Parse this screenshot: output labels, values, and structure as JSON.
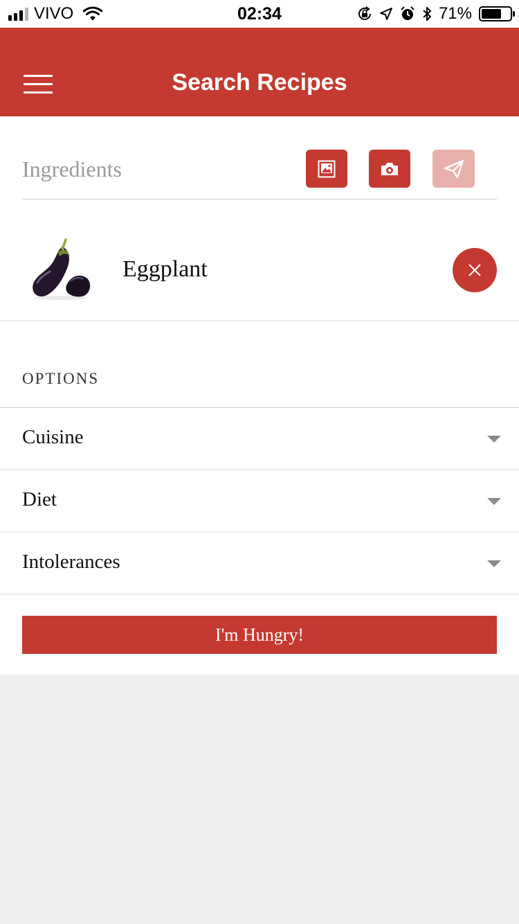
{
  "status_bar": {
    "carrier": "VIVO",
    "time": "02:34",
    "battery_percent": "71%",
    "battery_level": 0.71,
    "icons": [
      "signal-icon",
      "wifi-icon",
      "orientation-lock-icon",
      "location-icon",
      "alarm-icon",
      "bluetooth-icon",
      "battery-icon"
    ]
  },
  "header": {
    "title": "Search Recipes",
    "menu_icon": "hamburger-menu-icon"
  },
  "ingredients": {
    "placeholder": "Ingredients",
    "value": "",
    "buttons": [
      {
        "icon": "image-gallery-icon",
        "enabled": true
      },
      {
        "icon": "camera-icon",
        "enabled": true
      },
      {
        "icon": "send-icon",
        "enabled": false
      }
    ],
    "items": [
      {
        "name": "Eggplant",
        "image": "eggplant-image",
        "remove_icon": "close-icon"
      }
    ]
  },
  "options": {
    "heading": "OPTIONS",
    "rows": [
      {
        "label": "Cuisine",
        "icon": "caret-down-icon"
      },
      {
        "label": "Diet",
        "icon": "caret-down-icon"
      },
      {
        "label": "Intolerances",
        "icon": "caret-down-icon"
      }
    ]
  },
  "submit": {
    "label": "I'm Hungry!"
  },
  "colors": {
    "accent": "#c43a31",
    "accent_disabled": "#e9b0ac",
    "background": "#efefef"
  }
}
